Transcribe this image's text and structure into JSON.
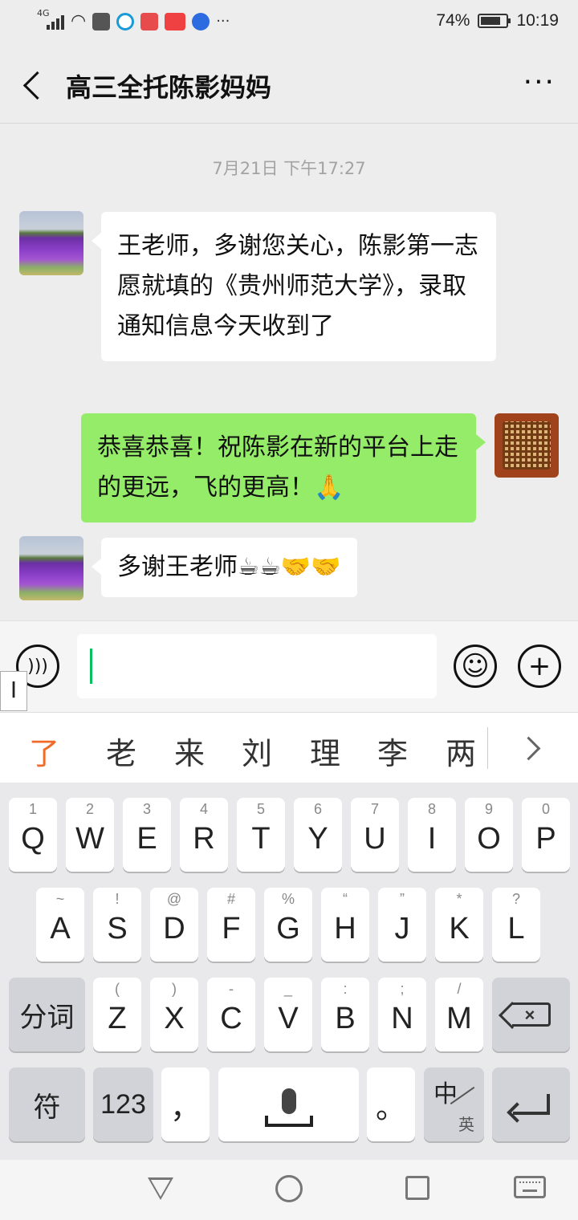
{
  "status_bar": {
    "network": "4G",
    "battery_percent": "74%",
    "time": "10:19",
    "more": "···",
    "app_icons": [
      "wifi-icon",
      "voice-app-icon",
      "circle-app-icon",
      "heart-app-icon",
      "toutiao-icon",
      "baidu-paw-icon"
    ]
  },
  "header": {
    "title": "高三全托陈影妈妈",
    "more": "···"
  },
  "chat": {
    "timestamp": "7月21日 下午17:27",
    "messages": [
      {
        "side": "left",
        "text": "王老师，多谢您关心，陈影第一志愿就填的《贵州师范大学》，录取通知信息今天收到了"
      },
      {
        "side": "right",
        "text": "恭喜恭喜！祝陈影在新的平台上走的更远，飞的更高！🙏"
      },
      {
        "side": "left",
        "text": "多谢王老师☕☕🤝🤝"
      }
    ]
  },
  "input": {
    "value": "",
    "cursor_tab": "I"
  },
  "candidates": [
    "了",
    "老",
    "来",
    "刘",
    "理",
    "李",
    "两"
  ],
  "keyboard": {
    "row1": [
      {
        "sub": "1",
        "main": "Q"
      },
      {
        "sub": "2",
        "main": "W"
      },
      {
        "sub": "3",
        "main": "E"
      },
      {
        "sub": "4",
        "main": "R"
      },
      {
        "sub": "5",
        "main": "T"
      },
      {
        "sub": "6",
        "main": "Y"
      },
      {
        "sub": "7",
        "main": "U"
      },
      {
        "sub": "8",
        "main": "I"
      },
      {
        "sub": "9",
        "main": "O"
      },
      {
        "sub": "0",
        "main": "P"
      }
    ],
    "row2": [
      {
        "sub": "~",
        "main": "A"
      },
      {
        "sub": "!",
        "main": "S"
      },
      {
        "sub": "@",
        "main": "D"
      },
      {
        "sub": "#",
        "main": "F"
      },
      {
        "sub": "%",
        "main": "G"
      },
      {
        "sub": "“",
        "main": "H"
      },
      {
        "sub": "”",
        "main": "J"
      },
      {
        "sub": "*",
        "main": "K"
      },
      {
        "sub": "?",
        "main": "L"
      }
    ],
    "row3": [
      {
        "sub": "(",
        "main": "Z"
      },
      {
        "sub": ")",
        "main": "X"
      },
      {
        "sub": "-",
        "main": "C"
      },
      {
        "sub": "_",
        "main": "V"
      },
      {
        "sub": ":",
        "main": "B"
      },
      {
        "sub": ";",
        "main": "N"
      },
      {
        "sub": "/",
        "main": "M"
      }
    ],
    "segment_key": "分词",
    "symbol_key": "符",
    "numeric_key": "123",
    "comma_key": "，",
    "period_key": "。",
    "lang_zh": "中",
    "lang_en": "英"
  }
}
